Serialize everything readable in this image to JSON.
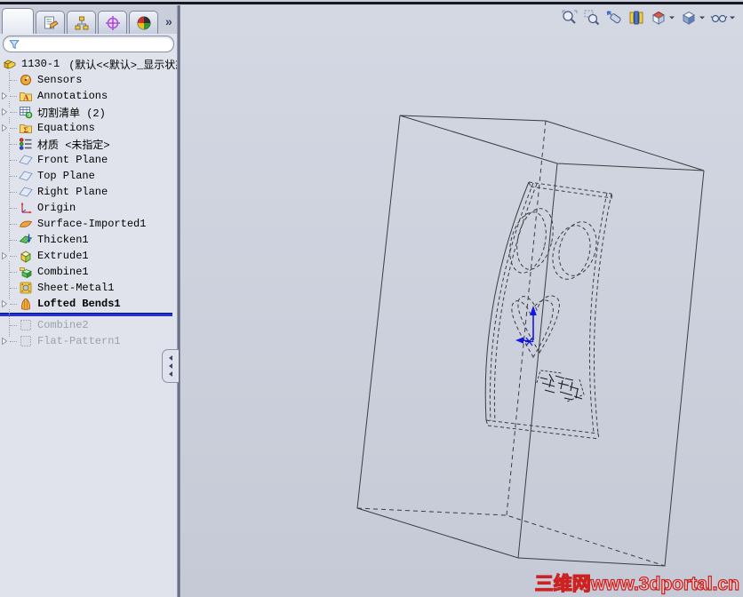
{
  "tabs": {
    "overflow_chevron": "»",
    "items": [
      {
        "name": "featuremanager-design-tree",
        "icon": "part",
        "active": true
      },
      {
        "name": "propertymanager",
        "icon": "propertymgr",
        "active": false
      },
      {
        "name": "configurationmanager",
        "icon": "configmgr",
        "active": false
      },
      {
        "name": "dimxpertmanager",
        "icon": "dimxpert",
        "active": false
      },
      {
        "name": "displaymanager",
        "icon": "displaymgr",
        "active": false
      }
    ]
  },
  "filter": {
    "value": "",
    "placeholder": ""
  },
  "tree": {
    "rollback_after": 15,
    "rollback_color": "#2232d4",
    "items": [
      {
        "id": "root-part",
        "label": "1130-1",
        "suffix": "(默认<<默认>_显示状态",
        "icon": "part",
        "root": true
      },
      {
        "id": "sensors",
        "label": "Sensors",
        "icon": "sensors"
      },
      {
        "id": "annotations",
        "label": "Annotations",
        "icon": "annotations",
        "expandable": true
      },
      {
        "id": "cut-list",
        "label": "切割清单 (2)",
        "icon": "cutlist",
        "expandable": true
      },
      {
        "id": "equations",
        "label": "Equations",
        "icon": "equations",
        "expandable": true
      },
      {
        "id": "material",
        "label": "材质 <未指定>",
        "icon": "material"
      },
      {
        "id": "front-plane",
        "label": "Front Plane",
        "icon": "plane"
      },
      {
        "id": "top-plane",
        "label": "Top Plane",
        "icon": "plane"
      },
      {
        "id": "right-plane",
        "label": "Right Plane",
        "icon": "plane"
      },
      {
        "id": "origin",
        "label": "Origin",
        "icon": "origin"
      },
      {
        "id": "surface-imported1",
        "label": "Surface-Imported1",
        "icon": "surface"
      },
      {
        "id": "thicken1",
        "label": "Thicken1",
        "icon": "thicken"
      },
      {
        "id": "extrude1",
        "label": "Extrude1",
        "icon": "extrude",
        "expandable": true
      },
      {
        "id": "combine1",
        "label": "Combine1",
        "icon": "combine"
      },
      {
        "id": "sheet-metal1",
        "label": "Sheet-Metal1",
        "icon": "sheetmetal"
      },
      {
        "id": "lofted-bends1",
        "label": "Lofted Bends1",
        "icon": "loft",
        "expandable": true,
        "selected": true
      },
      {
        "id": "combine2",
        "label": "Combine2",
        "icon": "suppressed",
        "suppressed": true
      },
      {
        "id": "flat-pattern1",
        "label": "Flat-Pattern1",
        "icon": "suppressed",
        "suppressed": true,
        "expandable": true
      }
    ]
  },
  "view_toolbar": {
    "buttons": [
      {
        "name": "zoom-to-fit",
        "has_dropdown": false
      },
      {
        "name": "zoom-to-area",
        "has_dropdown": false
      },
      {
        "name": "previous-view",
        "has_dropdown": false
      },
      {
        "name": "section-view",
        "has_dropdown": false
      },
      {
        "name": "view-orientation",
        "has_dropdown": true
      },
      {
        "name": "display-style",
        "has_dropdown": true
      },
      {
        "name": "hide-show-items",
        "has_dropdown": true
      }
    ]
  },
  "viewport": {
    "wire_color": "#3c3c42",
    "origin_color": "#1515e8"
  },
  "watermark": {
    "text": "三维网www.3dportal.cn",
    "color": "#cc2222"
  }
}
